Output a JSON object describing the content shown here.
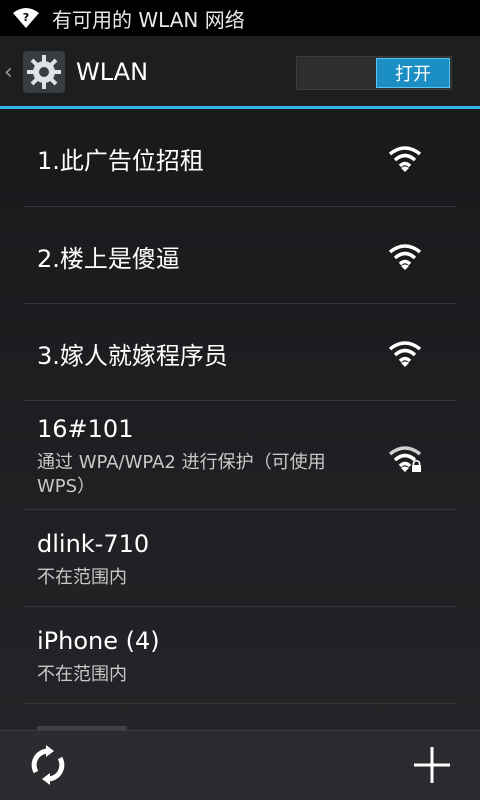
{
  "status_bar": {
    "text": "有可用的 WLAN 网络",
    "icon": "wifi-question-icon"
  },
  "action_bar": {
    "back_glyph": "‹",
    "title": "WLAN",
    "toggle_label": "打开"
  },
  "networks": [
    {
      "name": "1.此广告位招租",
      "status": "",
      "secured": false
    },
    {
      "name": "2.楼上是傻逼",
      "status": "",
      "secured": false
    },
    {
      "name": "3.嫁人就嫁程序员",
      "status": "",
      "secured": false
    },
    {
      "name": "16#101",
      "status": "通过 WPA/WPA2 进行保护（可使用 WPS）",
      "secured": true
    },
    {
      "name": "dlink-710",
      "status": "不在范围内",
      "secured": false
    },
    {
      "name": "iPhone (4)",
      "status": "不在范围内",
      "secured": false
    }
  ],
  "bottom_bar": {
    "scan_icon": "refresh-icon",
    "add_icon": "add-icon"
  },
  "colors": {
    "accent": "#33b5e5",
    "toggle_on": "#1b8fc4"
  }
}
